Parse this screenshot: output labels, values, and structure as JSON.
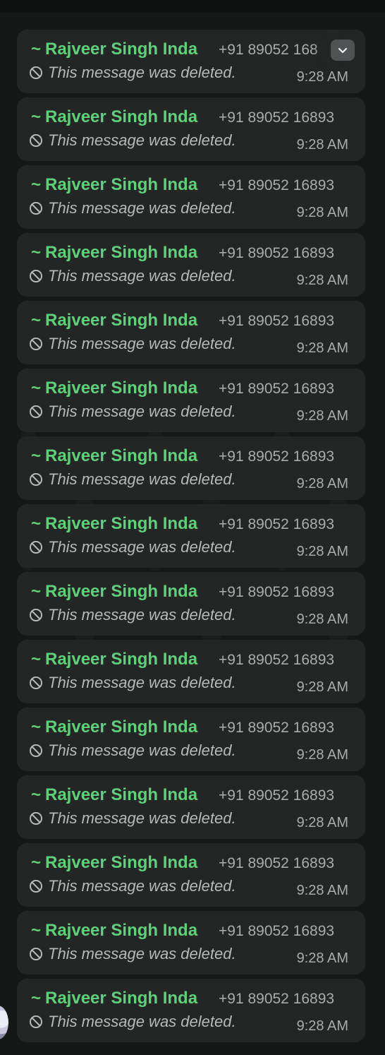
{
  "messages": [
    {
      "sender_prefix": "~",
      "sender_name": "Rajveer Singh Inda",
      "sender_phone": "+91 89052 168",
      "text": "This message was deleted.",
      "time": "9:28 AM"
    },
    {
      "sender_prefix": "~",
      "sender_name": "Rajveer Singh Inda",
      "sender_phone": "+91 89052 16893",
      "text": "This message was deleted.",
      "time": "9:28 AM"
    },
    {
      "sender_prefix": "~",
      "sender_name": "Rajveer Singh Inda",
      "sender_phone": "+91 89052 16893",
      "text": "This message was deleted.",
      "time": "9:28 AM"
    },
    {
      "sender_prefix": "~",
      "sender_name": "Rajveer Singh Inda",
      "sender_phone": "+91 89052 16893",
      "text": "This message was deleted.",
      "time": "9:28 AM"
    },
    {
      "sender_prefix": "~",
      "sender_name": "Rajveer Singh Inda",
      "sender_phone": "+91 89052 16893",
      "text": "This message was deleted.",
      "time": "9:28 AM"
    },
    {
      "sender_prefix": "~",
      "sender_name": "Rajveer Singh Inda",
      "sender_phone": "+91 89052 16893",
      "text": "This message was deleted.",
      "time": "9:28 AM"
    },
    {
      "sender_prefix": "~",
      "sender_name": "Rajveer Singh Inda",
      "sender_phone": "+91 89052 16893",
      "text": "This message was deleted.",
      "time": "9:28 AM"
    },
    {
      "sender_prefix": "~",
      "sender_name": "Rajveer Singh Inda",
      "sender_phone": "+91 89052 16893",
      "text": "This message was deleted.",
      "time": "9:28 AM"
    },
    {
      "sender_prefix": "~",
      "sender_name": "Rajveer Singh Inda",
      "sender_phone": "+91 89052 16893",
      "text": "This message was deleted.",
      "time": "9:28 AM"
    },
    {
      "sender_prefix": "~",
      "sender_name": "Rajveer Singh Inda",
      "sender_phone": "+91 89052 16893",
      "text": "This message was deleted.",
      "time": "9:28 AM"
    },
    {
      "sender_prefix": "~",
      "sender_name": "Rajveer Singh Inda",
      "sender_phone": "+91 89052 16893",
      "text": "This message was deleted.",
      "time": "9:28 AM"
    },
    {
      "sender_prefix": "~",
      "sender_name": "Rajveer Singh Inda",
      "sender_phone": "+91 89052 16893",
      "text": "This message was deleted.",
      "time": "9:28 AM"
    },
    {
      "sender_prefix": "~",
      "sender_name": "Rajveer Singh Inda",
      "sender_phone": "+91 89052 16893",
      "text": "This message was deleted.",
      "time": "9:28 AM"
    },
    {
      "sender_prefix": "~",
      "sender_name": "Rajveer Singh Inda",
      "sender_phone": "+91 89052 16893",
      "text": "This message was deleted.",
      "time": "9:28 AM"
    },
    {
      "sender_prefix": "~",
      "sender_name": "Rajveer Singh Inda",
      "sender_phone": "+91 89052 16893",
      "text": "This message was deleted.",
      "time": "9:28 AM"
    }
  ],
  "icons": {
    "deleted": "prohibited-icon",
    "message_menu": "chevron-down-icon",
    "avatar": "avatar"
  },
  "colors": {
    "sender_name": "#5fd07a",
    "bubble": "#242626",
    "background": "#161717",
    "muted_text": "#a8acad"
  }
}
